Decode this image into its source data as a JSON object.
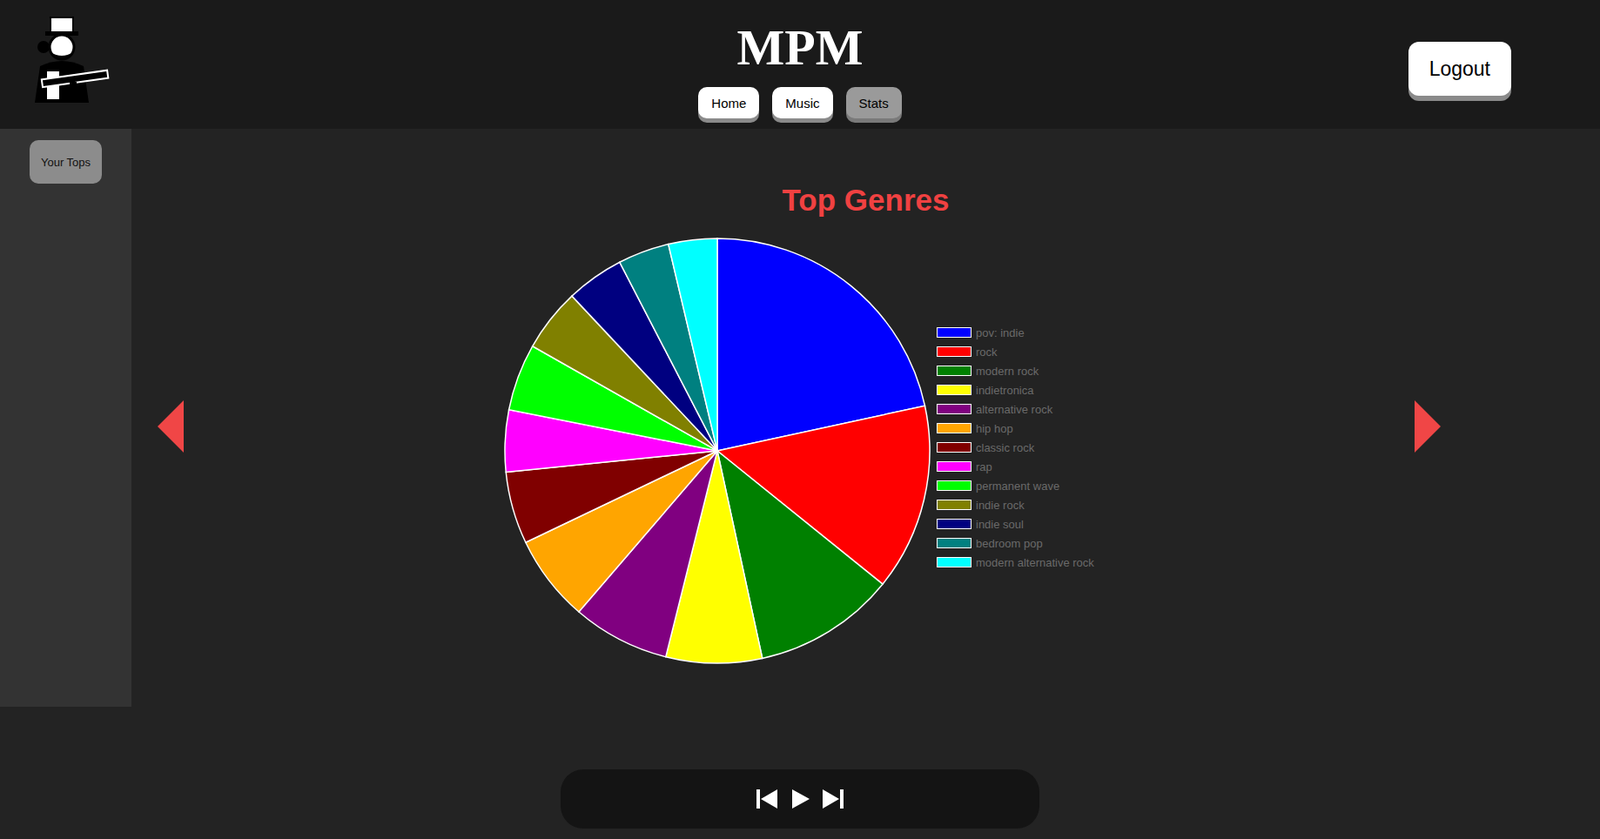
{
  "header": {
    "title": "MPM",
    "nav": [
      {
        "label": "Home",
        "selected": false
      },
      {
        "label": "Music",
        "selected": false
      },
      {
        "label": "Stats",
        "selected": true
      }
    ],
    "logout": "Logout"
  },
  "sidebar": {
    "items": [
      {
        "label": "Your Tops",
        "selected": true
      }
    ]
  },
  "chart": {
    "title": "Top Genres",
    "slices": [
      {
        "label": "pov: indie",
        "value": 21.6,
        "color": "#0000ff"
      },
      {
        "label": "rock",
        "value": 14.2,
        "color": "#ff0000"
      },
      {
        "label": "modern rock",
        "value": 10.8,
        "color": "#008000"
      },
      {
        "label": "indietronica",
        "value": 7.3,
        "color": "#ffff00"
      },
      {
        "label": "alternative rock",
        "value": 7.4,
        "color": "#800080"
      },
      {
        "label": "hip hop",
        "value": 6.6,
        "color": "#ffa500"
      },
      {
        "label": "classic rock",
        "value": 5.5,
        "color": "#800000"
      },
      {
        "label": "rap",
        "value": 4.7,
        "color": "#ff00ff"
      },
      {
        "label": "permanent wave",
        "value": 5.1,
        "color": "#00ff00"
      },
      {
        "label": "indie rock",
        "value": 4.8,
        "color": "#808000"
      },
      {
        "label": "indie soul",
        "value": 4.4,
        "color": "#000080"
      },
      {
        "label": "bedroom pop",
        "value": 3.9,
        "color": "#008080"
      },
      {
        "label": "modern alternative rock",
        "value": 3.7,
        "color": "#00ffff"
      }
    ]
  }
}
